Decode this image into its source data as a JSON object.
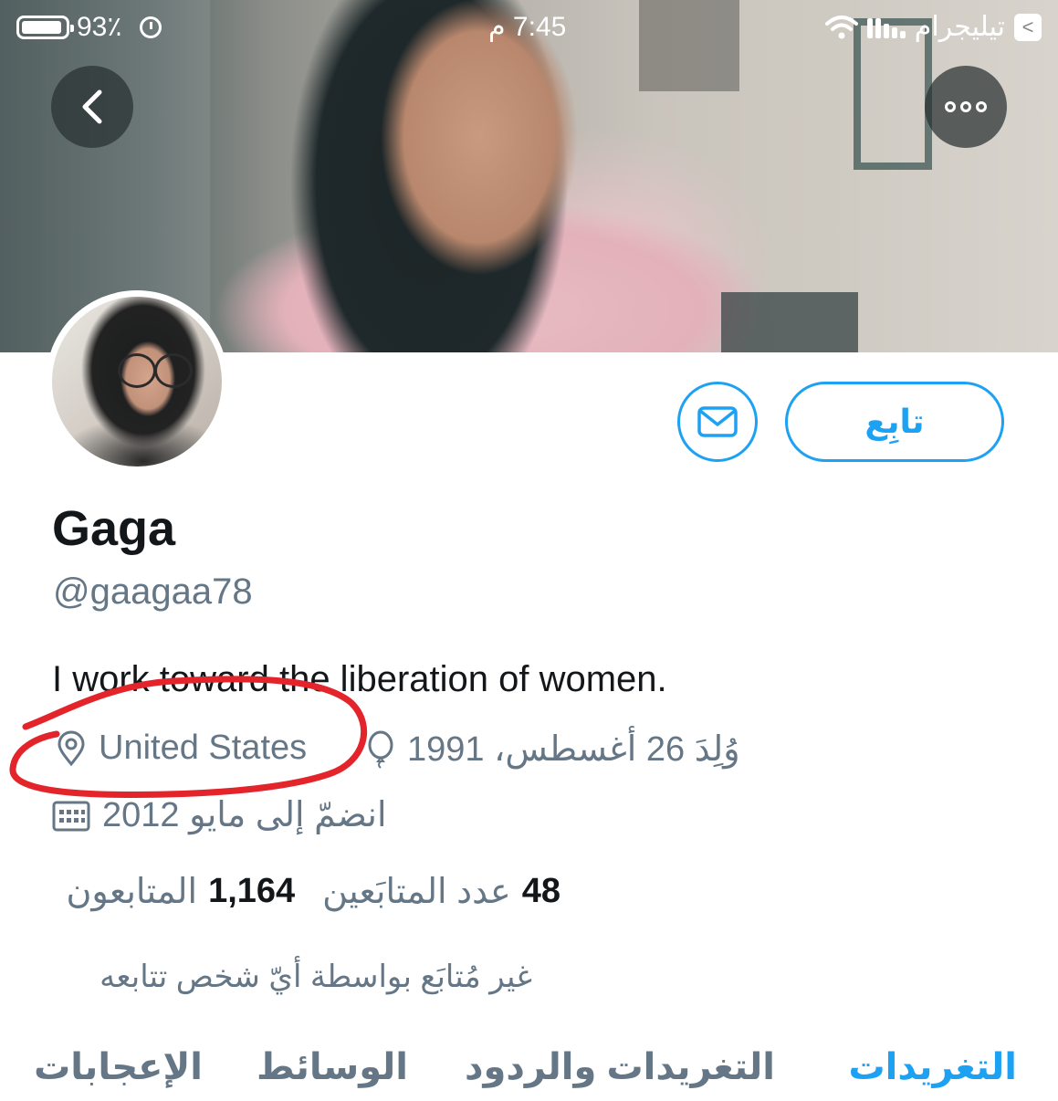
{
  "status_bar": {
    "battery": "93٪",
    "time": "7:45 م",
    "carrier": "تيليجرام",
    "back_app_glyph": "<"
  },
  "header": {
    "back_glyph": "‹",
    "more_icon": "ellipsis-circle-icon"
  },
  "actions": {
    "follow_label": "تابِع",
    "message_icon": "envelope-icon"
  },
  "profile": {
    "name": "Gaga",
    "handle": "@gaagaa78",
    "bio": "I work toward the liberation of women.",
    "location": "United States",
    "birth": "وُلِدَ 26 أغسطس، 1991",
    "joined": "انضمّ إلى مايو 2012"
  },
  "stats": {
    "following_count": "48",
    "following_label": "عدد المتابَعين",
    "followers_count": "1,164",
    "followers_label": "المتابعون"
  },
  "social_context": "غير مُتابَع بواسطة أيّ شخص تتابعه",
  "tabs": [
    {
      "label": "التغريدات",
      "active": true
    },
    {
      "label": "التغريدات والردود",
      "active": false
    },
    {
      "label": "الوسائط",
      "active": false
    },
    {
      "label": "الإعجابات",
      "active": false
    }
  ],
  "colors": {
    "accent": "#1da1f2",
    "secondary_text": "#657786",
    "annotation": "#e3242b"
  }
}
